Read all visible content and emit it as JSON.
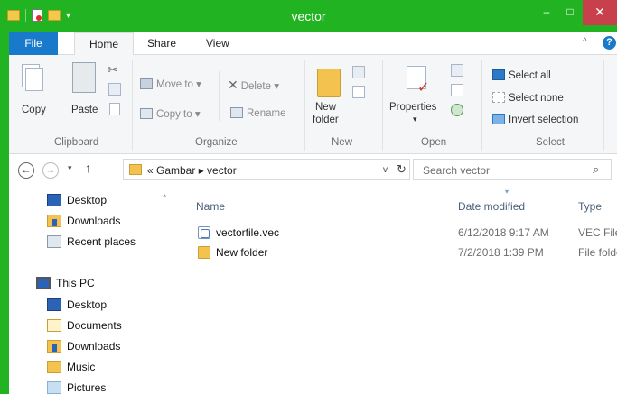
{
  "window": {
    "title": "vector",
    "minimize": "–",
    "maximize": "□",
    "close": "✕",
    "qat_arrow": "▾"
  },
  "ribbon_tabs": {
    "file": "File",
    "home": "Home",
    "share": "Share",
    "view": "View",
    "collapse_caret": "^",
    "help": "?"
  },
  "ribbon": {
    "clipboard": {
      "label": "Clipboard",
      "copy": "Copy",
      "paste": "Paste"
    },
    "organize": {
      "label": "Organize",
      "move_to": "Move to",
      "copy_to": "Copy to",
      "delete": "Delete",
      "rename": "Rename",
      "dropdown": "▾"
    },
    "new": {
      "label": "New",
      "new_folder_line1": "New",
      "new_folder_line2": "folder"
    },
    "open": {
      "label": "Open",
      "properties": "Properties",
      "properties_caret": "▾"
    },
    "select": {
      "label": "Select",
      "select_all": "Select all",
      "select_none": "Select none",
      "invert_selection": "Invert selection"
    }
  },
  "address": {
    "back": "←",
    "forward": "→",
    "recent_dropdown": "▾",
    "up": "↑",
    "breadcrumb": "« Gambar ▸ vector",
    "chevron": "v",
    "refresh": "↻",
    "search_placeholder": "Search vector",
    "search_icon": "⌕"
  },
  "nav_pane": {
    "scroll_up": "^",
    "items": [
      {
        "label": "Desktop",
        "icon": "desktop-icon"
      },
      {
        "label": "Downloads",
        "icon": "downloads-icon"
      },
      {
        "label": "Recent places",
        "icon": "recent-places-icon"
      },
      {
        "label": "This PC",
        "icon": "this-pc-icon"
      },
      {
        "label": "Desktop",
        "icon": "desktop-icon"
      },
      {
        "label": "Documents",
        "icon": "documents-icon"
      },
      {
        "label": "Downloads",
        "icon": "downloads-icon"
      },
      {
        "label": "Music",
        "icon": "music-icon"
      },
      {
        "label": "Pictures",
        "icon": "pictures-icon"
      }
    ]
  },
  "file_list": {
    "columns": {
      "name": "Name",
      "date_modified": "Date modified",
      "type": "Type"
    },
    "sort_caret": "▾",
    "rows": [
      {
        "name": "vectorfile.vec",
        "date": "6/12/2018 9:17 AM",
        "type": "VEC File",
        "icon": "vec-file-icon"
      },
      {
        "name": "New folder",
        "date": "7/2/2018 1:39 PM",
        "type": "File folder",
        "icon": "folder-icon"
      }
    ]
  },
  "colors": {
    "titlebar": "#21b321",
    "close_button": "#c8404b",
    "file_tab": "#1979ca",
    "ribbon_bg": "#f5f6f7",
    "column_header": "#4c607a"
  }
}
